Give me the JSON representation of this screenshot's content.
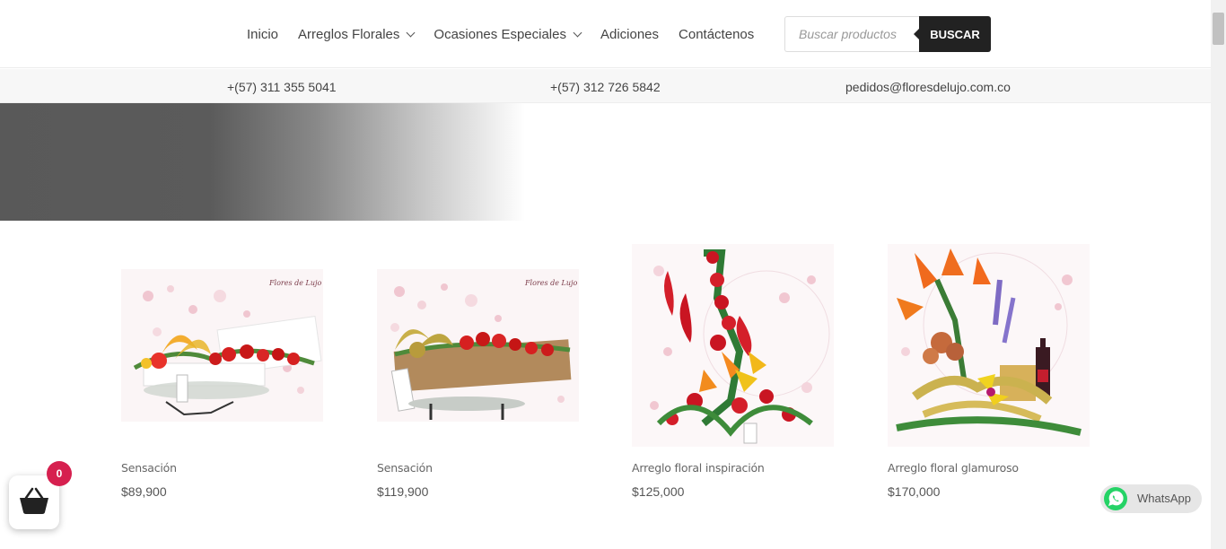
{
  "nav": {
    "items": [
      {
        "label": "Inicio",
        "dropdown": false
      },
      {
        "label": "Arreglos Florales",
        "dropdown": true
      },
      {
        "label": "Ocasiones Especiales",
        "dropdown": true
      },
      {
        "label": "Adiciones",
        "dropdown": false
      },
      {
        "label": "Contáctenos",
        "dropdown": false
      }
    ]
  },
  "search": {
    "placeholder": "Buscar productos",
    "button_label": "BUSCAR"
  },
  "contact_bar": {
    "phone_1": "+(57) 311 355 5041",
    "phone_2": "+(57) 312 726 5842",
    "email": "pedidos@floresdelujo.com.co"
  },
  "products": [
    {
      "name": "Sensación",
      "price": "$89,900"
    },
    {
      "name": "Sensación",
      "price": "$119,900"
    },
    {
      "name": "Arreglo floral inspiración",
      "price": "$125,000"
    },
    {
      "name": "Arreglo floral glamuroso",
      "price": "$170,000"
    }
  ],
  "cart": {
    "count": "0"
  },
  "whatsapp": {
    "label": "WhatsApp"
  },
  "colors": {
    "cart_badge": "#d6204f",
    "search_button": "#222222",
    "whatsapp": "#25d366"
  }
}
